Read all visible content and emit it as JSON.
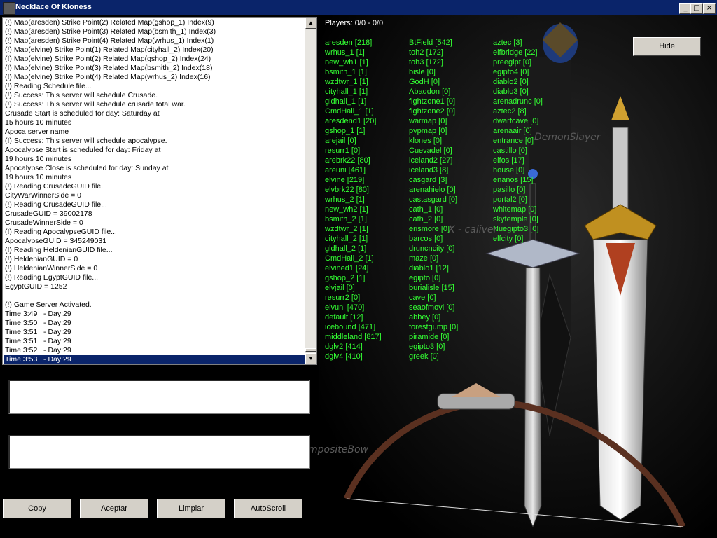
{
  "window": {
    "title": "Necklace Of Kloness",
    "minimize_glyph": "_",
    "maximize_glyph": "□",
    "close_glyph": "×"
  },
  "log": {
    "lines": [
      "(!) Map(aresden) Strike Point(2) Related Map(gshop_1) Index(9)",
      "(!) Map(aresden) Strike Point(3) Related Map(bsmith_1) Index(3)",
      "(!) Map(aresden) Strike Point(4) Related Map(wrhus_1) Index(1)",
      "(!) Map(elvine) Strike Point(1) Related Map(cityhall_2) Index(20)",
      "(!) Map(elvine) Strike Point(2) Related Map(gshop_2) Index(24)",
      "(!) Map(elvine) Strike Point(3) Related Map(bsmith_2) Index(18)",
      "(!) Map(elvine) Strike Point(4) Related Map(wrhus_2) Index(16)",
      "(!) Reading Schedule file...",
      "(!) Success: This server will schedule Crusade.",
      "(!) Success: This server will schedule crusade total war.",
      "Crusade Start is scheduled for day: Saturday at",
      "15 hours 10 minutes",
      "Apoca server name",
      "(!) Success: This server will schedule apocalypse.",
      "Apocalypse Start is scheduled for day: Friday at",
      "19 hours 10 minutes",
      "Apocalypse Close is scheduled for day: Sunday at",
      "19 hours 10 minutes",
      "(!) Reading CrusadeGUID file...",
      "CityWarWinnerSide = 0",
      "(!) Reading CrusadeGUID file...",
      "CrusadeGUID = 39002178",
      "CrusadeWinnerSide = 0",
      "(!) Reading ApocalypseGUID file...",
      "ApocalypseGUID = 345249031",
      "(!) Reading HeldenianGUID file...",
      "(!) HeldenianGUID = 0",
      "(!) HeldenianWinnerSide = 0",
      "(!) Reading EgyptGUID file...",
      "EgyptGUID = 1252",
      "",
      "(!) Game Server Activated.",
      "Time 3:49   - Day:29",
      "Time 3:50   - Day:29",
      "Time 3:51   - Day:29",
      "Time 3:51   - Day:29",
      "Time 3:52   - Day:29",
      "Time 3:53   - Day:29"
    ],
    "selected_index": 37
  },
  "buttons": {
    "copy": "Copy",
    "accept": "Aceptar",
    "clear": "Limpiar",
    "autoscroll": "AutoScroll",
    "hide": "Hide"
  },
  "players_label": "Players: 0/0 - 0/0",
  "map_columns": [
    [
      "aresden [218]",
      "wrhus_1 [1]",
      "new_wh1 [1]",
      "bsmith_1 [1]",
      "wzdtwr_1 [1]",
      "cityhall_1 [1]",
      "gldhall_1 [1]",
      "CmdHall_1 [1]",
      "aresdend1 [20]",
      "gshop_1 [1]",
      "arejail [0]",
      "resurr1 [0]",
      "arebrk22 [80]",
      "areuni [461]",
      "elvine [219]",
      "elvbrk22 [80]",
      "wrhus_2 [1]",
      "new_wh2 [1]",
      "bsmith_2 [1]",
      "wzdtwr_2 [1]",
      "cityhall_2 [1]",
      "gldhall_2 [1]",
      "CmdHall_2 [1]",
      "elvined1 [24]",
      "gshop_2 [1]",
      "elvjail [0]",
      "resurr2 [0]",
      "elvuni [470]",
      "default [12]",
      "icebound [471]",
      "middleland [817]",
      "dglv2 [414]",
      "dglv4 [410]"
    ],
    [
      "BtField [542]",
      "toh2 [172]",
      "toh3 [172]",
      "bisle [0]",
      "GodH [0]",
      "Abaddon [0]",
      "fightzone1 [0]",
      "fightzone2 [0]",
      "warmap [0]",
      "pvpmap [0]",
      "klones [0]",
      "Cuevadel [0]",
      "iceland2 [27]",
      "iceland3 [8]",
      "casgard [3]",
      "arenahielo [0]",
      "castasgard [0]",
      "cath_1 [0]",
      "cath_2 [0]",
      "erismore [0]",
      "barcos [0]",
      "druncncity [0]",
      "maze [0]",
      "diablo1 [12]",
      "egipto [0]",
      "burialisle [15]",
      "cave [0]",
      "seaofmovi [0]",
      "abbey [0]",
      "forestgump [0]",
      "piramide [0]",
      "egipto3 [0]",
      "greek [0]"
    ],
    [
      "aztec [3]",
      "elfbridge [22]",
      "preegipt [0]",
      "egipto4 [0]",
      "diablo2 [0]",
      "diablo3 [0]",
      "arenadrunc [0]",
      "aztec2 [8]",
      "dwarfcave [0]",
      "arenaair [0]",
      "entrance [0]",
      "castillo [0]",
      "elfos [17]",
      "house [0]",
      "enanos [15]",
      "pasillo [0]",
      "portal2 [0]",
      "whitemap [0]",
      "skytemple [0]",
      "Nuegipto3 [0]",
      "elfcity [0]"
    ]
  ],
  "watermarks": {
    "demonslayer": "DemonSlayer",
    "xcaliver": "X - caliver",
    "compositebow": "mpositeBow"
  }
}
